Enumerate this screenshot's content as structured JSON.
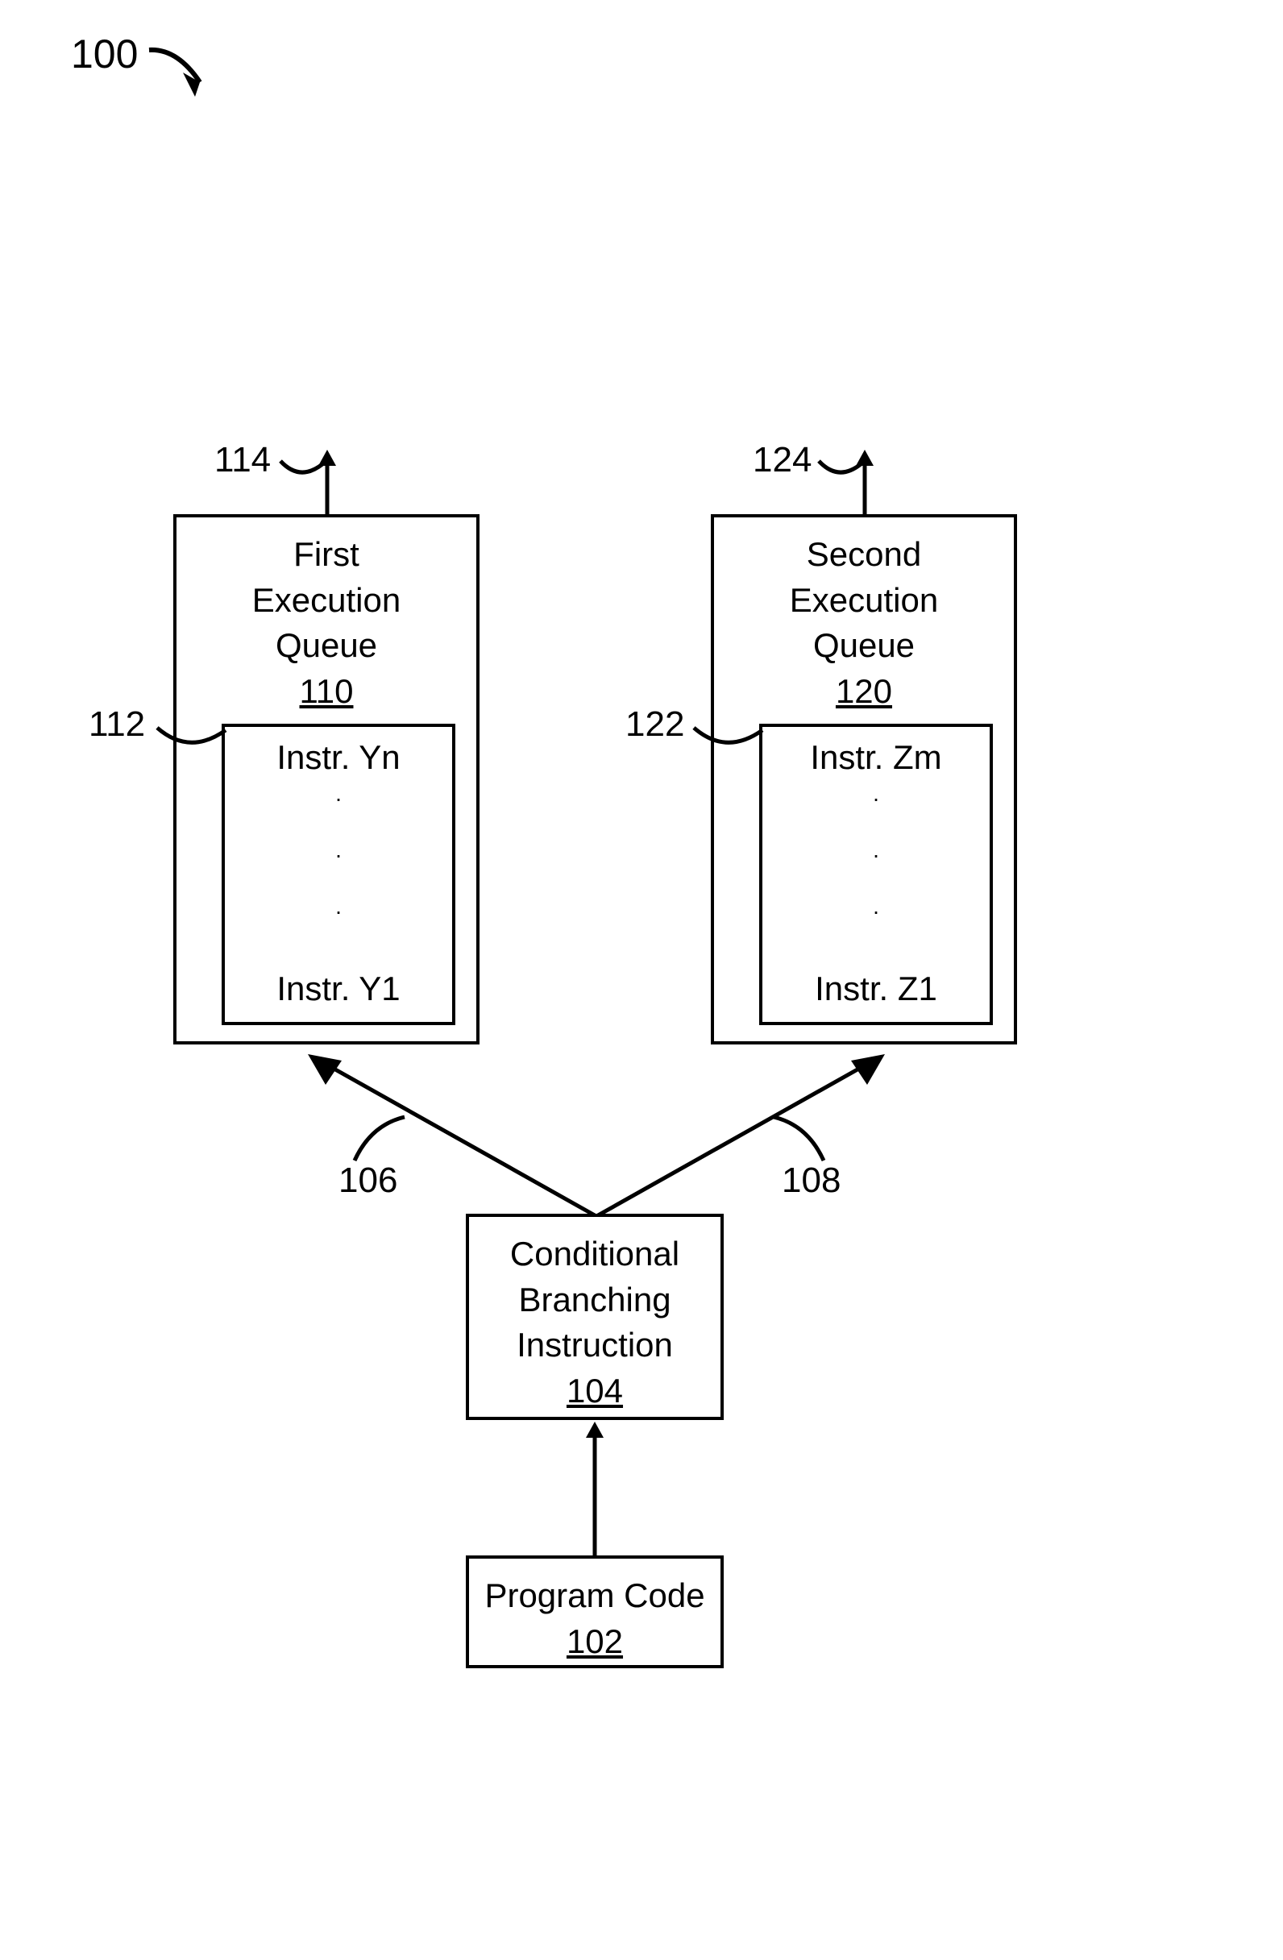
{
  "figureRef": "100",
  "programCode": {
    "title": "Program Code",
    "ref": "102"
  },
  "conditional": {
    "line1": "Conditional",
    "line2": "Branching",
    "line3": "Instruction",
    "ref": "104"
  },
  "branchLeftRef": "106",
  "branchRightRef": "108",
  "firstQueue": {
    "line1": "First",
    "line2": "Execution",
    "line3": "Queue",
    "ref": "110",
    "instrTop": "Instr. Yn",
    "instrBottom": "Instr. Y1",
    "innerRef": "112",
    "outRef": "114"
  },
  "secondQueue": {
    "line1": "Second",
    "line2": "Execution",
    "line3": "Queue",
    "ref": "120",
    "instrTop": "Instr. Zm",
    "instrBottom": "Instr. Z1",
    "innerRef": "122",
    "outRef": "124"
  }
}
